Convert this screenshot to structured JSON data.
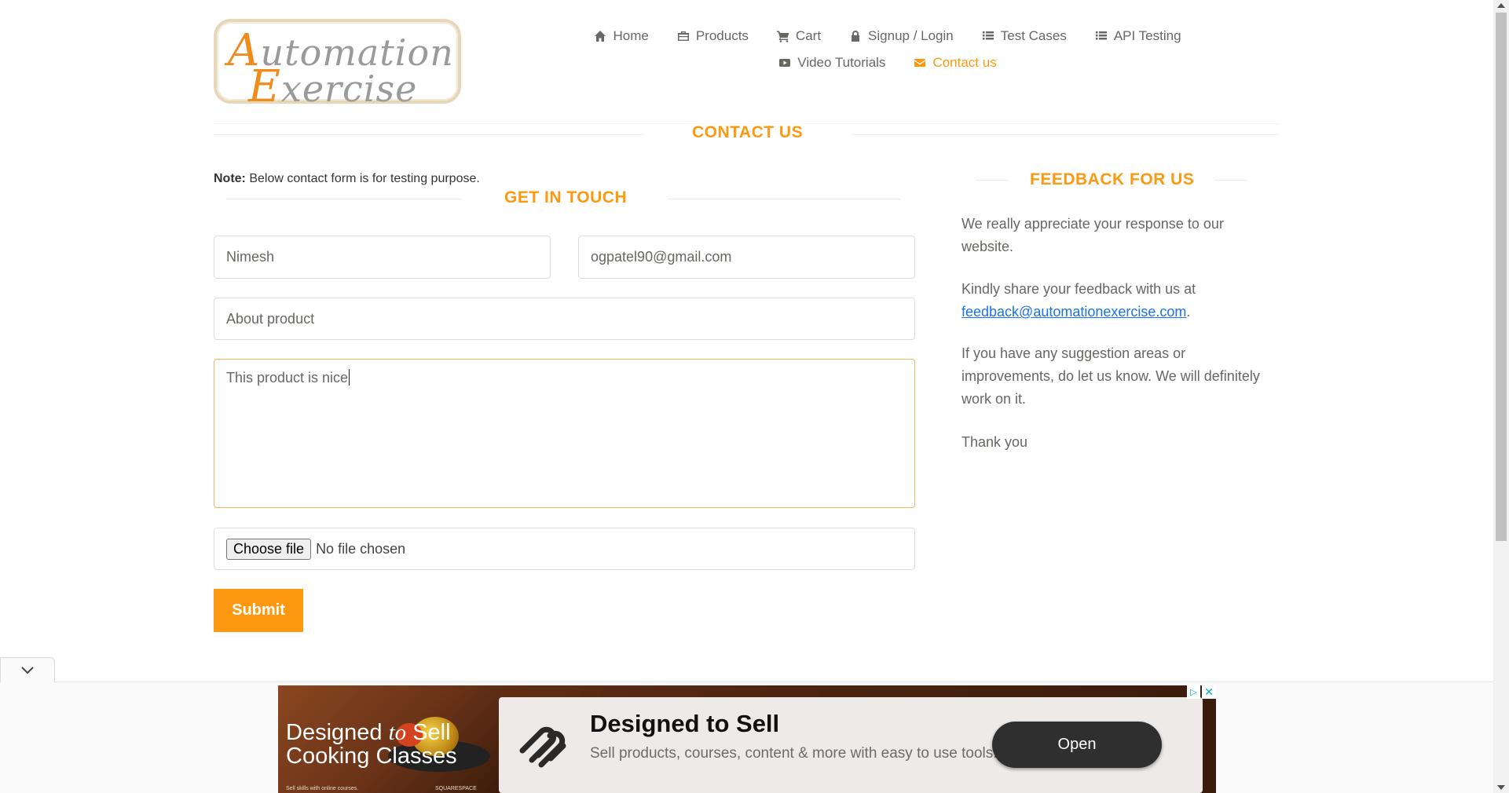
{
  "header": {
    "logo_line1_cap": "A",
    "logo_line1_rest": "utomation",
    "logo_line2_cap": "E",
    "logo_line2_rest": "xercise",
    "nav": [
      {
        "label": "Home",
        "icon": "home-icon"
      },
      {
        "label": "Products",
        "icon": "briefcase-icon"
      },
      {
        "label": "Cart",
        "icon": "cart-icon"
      },
      {
        "label": "Signup / Login",
        "icon": "lock-icon"
      },
      {
        "label": "Test Cases",
        "icon": "list-icon"
      },
      {
        "label": "API Testing",
        "icon": "list-icon"
      },
      {
        "label": "Video Tutorials",
        "icon": "youtube-icon"
      },
      {
        "label": "Contact us",
        "icon": "envelope-icon",
        "active": true
      }
    ]
  },
  "page": {
    "title": "Contact Us"
  },
  "contact_form": {
    "note_label": "Note:",
    "note_text": " Below contact form is for testing purpose.",
    "heading": "Get In Touch",
    "name_value": "Nimesh",
    "email_value": "ogpatel90@gmail.com",
    "subject_value": "About product",
    "message_value": "This product is nice",
    "file_button": "Choose file",
    "file_status": "No file chosen",
    "submit_label": "Submit"
  },
  "feedback": {
    "heading": "Feedback For Us",
    "p1": "We really appreciate your response to our website.",
    "p2_prefix": "Kindly share your feedback with us at ",
    "p2_email": "feedback@automationexercise.com",
    "p2_suffix": ".",
    "p3": "If you have any suggestion areas or improvements, do let us know. We will definitely work on it.",
    "p4": "Thank you"
  },
  "ad": {
    "left_line1_a": "Designed ",
    "left_line1_b": "to",
    "left_line1_c": " Sell",
    "left_line2": "Cooking Classes",
    "left_small": "Sell skills with online courses.",
    "left_brand": "SQUARESPACE",
    "title": "Designed to Sell",
    "description": "Sell products, courses, content & more with easy to use tools.",
    "button": "Open"
  },
  "colors": {
    "accent": "#fe980f",
    "text": "#696763",
    "link": "#1a73e8"
  }
}
